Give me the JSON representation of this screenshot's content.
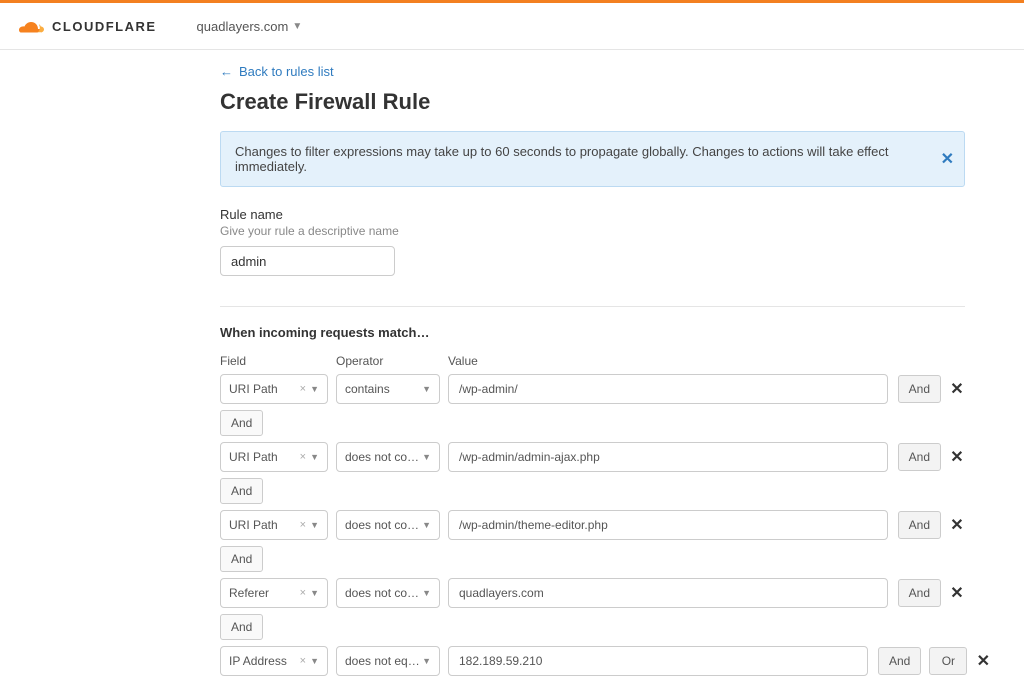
{
  "brand": {
    "name": "CLOUDFLARE"
  },
  "site_selector": {
    "domain": "quadlayers.com"
  },
  "back_link": {
    "label": "Back to rules list"
  },
  "page": {
    "title": "Create Firewall Rule"
  },
  "notice": {
    "text": "Changes to filter expressions may take up to 60 seconds to propagate globally. Changes to actions will take effect immediately."
  },
  "rule_name": {
    "label": "Rule name",
    "hint": "Give your rule a descriptive name",
    "value": "admin"
  },
  "match": {
    "heading": "When incoming requests match…",
    "headers": {
      "field": "Field",
      "operator": "Operator",
      "value": "Value"
    },
    "connector_label": "And",
    "and_label": "And",
    "or_label": "Or",
    "rows": [
      {
        "field": "URI Path",
        "operator": "contains",
        "value": "/wp-admin/",
        "show_or": false
      },
      {
        "field": "URI Path",
        "operator": "does not cont...",
        "value": "/wp-admin/admin-ajax.php",
        "show_or": false
      },
      {
        "field": "URI Path",
        "operator": "does not cont...",
        "value": "/wp-admin/theme-editor.php",
        "show_or": false
      },
      {
        "field": "Referer",
        "operator": "does not cont...",
        "value": "quadlayers.com",
        "show_or": false
      },
      {
        "field": "IP Address",
        "operator": "does not equal",
        "value": "182.189.59.210",
        "show_or": true
      }
    ]
  }
}
